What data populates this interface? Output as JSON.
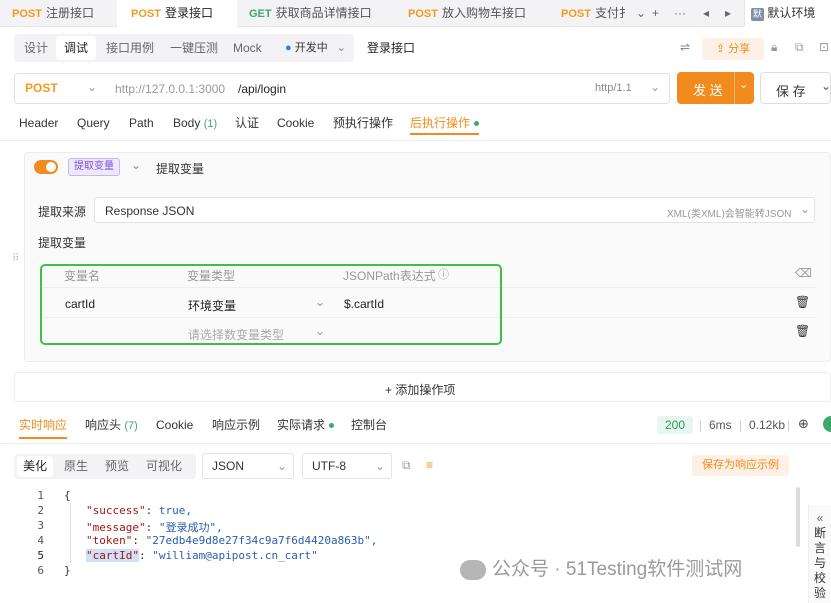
{
  "tabs": [
    {
      "method": "POST",
      "label": "注册接口"
    },
    {
      "method": "POST",
      "label": "登录接口"
    },
    {
      "method": "GET",
      "label": "获取商品详情接口"
    },
    {
      "method": "POST",
      "label": "放入购物车接口"
    },
    {
      "method": "POST",
      "label": "支付扌"
    }
  ],
  "tabbar": {
    "add": "+",
    "more": "···",
    "prev": "◂",
    "next": "▸",
    "env_icon": "默",
    "env": "默认环境"
  },
  "subtabs": [
    "设计",
    "调试",
    "接口用例",
    "一键压测",
    "Mock"
  ],
  "status_label": "开发中",
  "api_name": "登录接口",
  "share": "分享",
  "request": {
    "method": "POST",
    "base": "http://127.0.0.1:3000",
    "path": "/api/login",
    "protocol": "http/1.1",
    "send": "发 送",
    "save": "保 存"
  },
  "req_tabs": {
    "header": "Header",
    "query": "Query",
    "path": "Path",
    "body": "Body",
    "body_count": "(1)",
    "auth": "认证",
    "cookie": "Cookie",
    "pre": "预执行操作",
    "post": "后执行操作"
  },
  "extract": {
    "tag": "提取变量",
    "title": "提取变量",
    "source_label": "提取来源",
    "source_value": "Response JSON",
    "source_hint": "XML(类XML)会智能转JSON",
    "vars_label": "提取变量",
    "columns": [
      "变量名",
      "变量类型",
      "JSONPath表达式"
    ],
    "rows": [
      {
        "name": "cartId",
        "type": "环境变量",
        "path": "$.cartId"
      },
      {
        "name": "",
        "type": "请选择数变量类型",
        "path": ""
      }
    ],
    "add_op": "+ 添加操作项"
  },
  "response": {
    "tabs": [
      "实时响应",
      "响应头",
      "Cookie",
      "响应示例",
      "实际请求",
      "控制台"
    ],
    "header_count": "(7)",
    "status": "200",
    "time": "6ms",
    "size": "0.12kb",
    "view_tabs": [
      "美化",
      "原生",
      "预览",
      "可视化"
    ],
    "format": "JSON",
    "encoding": "UTF-8",
    "save_example": "保存为响应示例",
    "code": [
      {
        "n": "1",
        "t": "{"
      },
      {
        "n": "2",
        "k": "\"success\"",
        "v": "true,"
      },
      {
        "n": "3",
        "k": "\"message\"",
        "v": "\"登录成功\","
      },
      {
        "n": "4",
        "k": "\"token\"",
        "v": "\"27edb4e9d8e27f34c9a7f6d4420a863b\","
      },
      {
        "n": "5",
        "k": "\"cartId\"",
        "v": "\"william@apipost.cn_cart\""
      },
      {
        "n": "6",
        "t": "}"
      }
    ],
    "side": [
      "断",
      "言",
      "与",
      "校",
      "验"
    ]
  },
  "watermark": "公众号 · 51Testing软件测试网"
}
